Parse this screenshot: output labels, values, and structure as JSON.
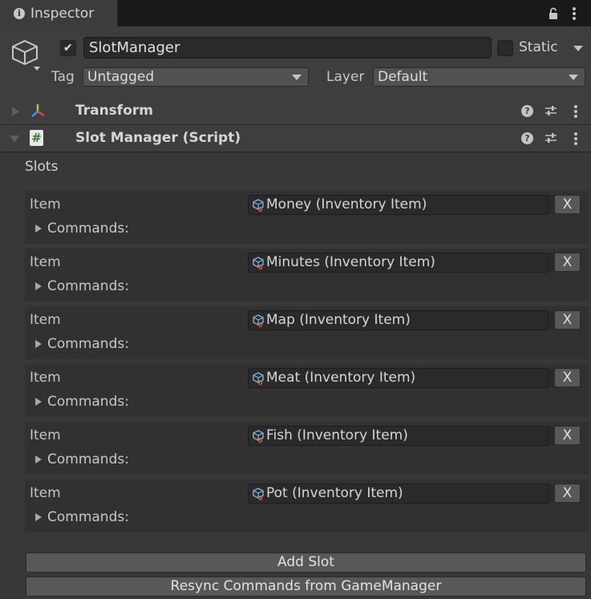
{
  "window": {
    "tab_title": "Inspector"
  },
  "gameobject": {
    "active_checked": true,
    "name": "SlotManager",
    "static_label": "Static",
    "tag_label": "Tag",
    "tag_value": "Untagged",
    "layer_label": "Layer",
    "layer_value": "Default"
  },
  "components": [
    {
      "name": "Transform",
      "expanded": false,
      "icon": "transform-axes-icon"
    },
    {
      "name": "Slot Manager (Script)",
      "expanded": true,
      "icon": "csharp-script-icon"
    }
  ],
  "slots_label": "Slots",
  "slots": [
    {
      "item_label": "Item",
      "value": "Money (Inventory Item)",
      "commands_label": "Commands:",
      "remove_label": "X"
    },
    {
      "item_label": "Item",
      "value": "Minutes (Inventory Item)",
      "commands_label": "Commands:",
      "remove_label": "X"
    },
    {
      "item_label": "Item",
      "value": "Map (Inventory Item)",
      "commands_label": "Commands:",
      "remove_label": "X"
    },
    {
      "item_label": "Item",
      "value": "Meat (Inventory Item)",
      "commands_label": "Commands:",
      "remove_label": "X"
    },
    {
      "item_label": "Item",
      "value": "Fish (Inventory Item)",
      "commands_label": "Commands:",
      "remove_label": "X"
    },
    {
      "item_label": "Item",
      "value": "Pot (Inventory Item)",
      "commands_label": "Commands:",
      "remove_label": "X"
    }
  ],
  "buttons": {
    "add_slot": "Add Slot",
    "resync": "Resync Commands from GameManager"
  },
  "colors": {
    "panel_bg": "#383838",
    "slot_bg": "#313131",
    "field_bg": "#2a2a2a",
    "button_bg": "#585858"
  }
}
